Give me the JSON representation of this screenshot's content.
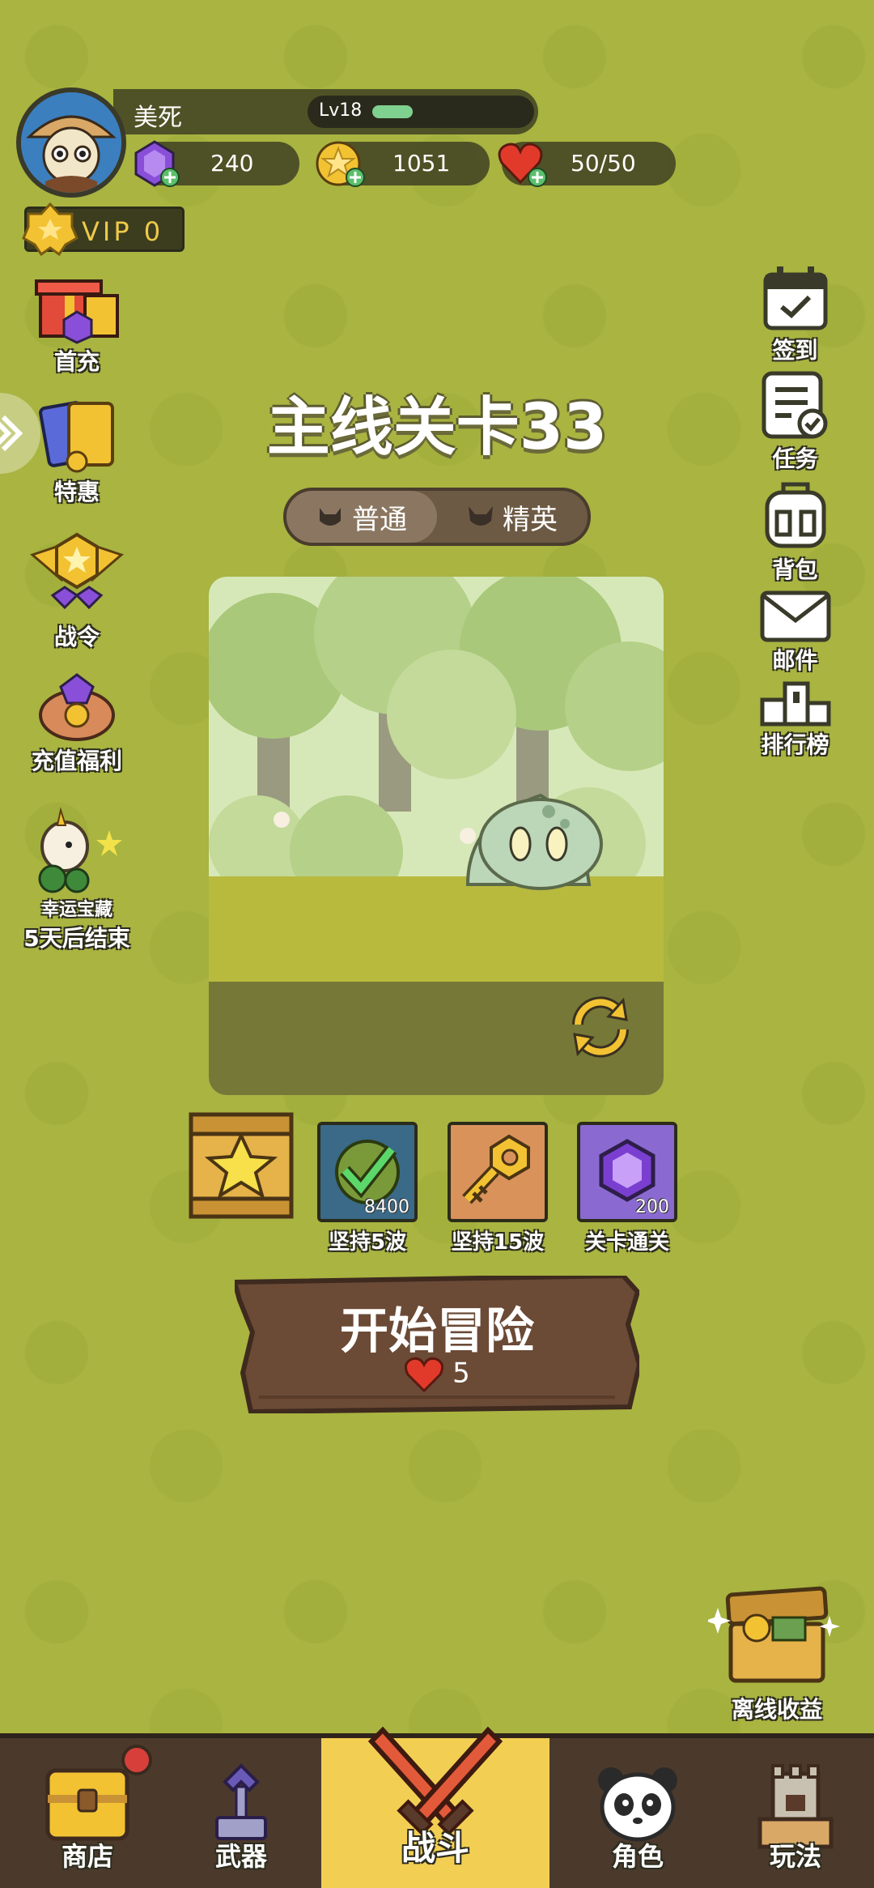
{
  "player": {
    "name": "美死",
    "level": "Lv18",
    "level_progress": 0.18,
    "vip": "VIP 0"
  },
  "resources": {
    "gems": "240",
    "coins": "1051",
    "stamina": "50/50"
  },
  "left_menu": [
    {
      "label": "首充",
      "icon": "gift-box-icon"
    },
    {
      "label": "特惠",
      "icon": "cards-icon"
    },
    {
      "label": "战令",
      "icon": "battle-pass-icon"
    },
    {
      "label": "充值福利",
      "icon": "piggy-bank-icon"
    },
    {
      "label": "幸运宝藏",
      "icon": "unicorn-treasure-icon",
      "sub": "5天后结束"
    }
  ],
  "right_menu": [
    {
      "label": "签到",
      "icon": "calendar-check-icon"
    },
    {
      "label": "任务",
      "icon": "task-list-icon"
    },
    {
      "label": "背包",
      "icon": "backpack-icon"
    },
    {
      "label": "邮件",
      "icon": "mail-icon"
    },
    {
      "label": "排行榜",
      "icon": "podium-icon"
    }
  ],
  "stage": {
    "title": "主线关卡33",
    "modes": [
      "普通",
      "精英"
    ],
    "active_mode": "普通"
  },
  "rewards": [
    {
      "label": "坚持5波",
      "count": "8400",
      "icon": "checkmark-coin-icon"
    },
    {
      "label": "坚持15波",
      "count": "",
      "icon": "golden-key-icon"
    },
    {
      "label": "关卡通关",
      "count": "200",
      "icon": "purple-gem-icon"
    }
  ],
  "start": {
    "label": "开始冒险",
    "cost": "5"
  },
  "offline": {
    "label": "离线收益"
  },
  "nav": [
    {
      "label": "商店",
      "icon": "shop-chest-icon"
    },
    {
      "label": "武器",
      "icon": "weapon-icon"
    },
    {
      "label": "战斗",
      "icon": "crossed-swords-icon"
    },
    {
      "label": "角色",
      "icon": "panda-icon"
    },
    {
      "label": "玩法",
      "icon": "castle-icon"
    }
  ],
  "colors": {
    "background": "#a9b441",
    "nav_active": "#f2cf52",
    "nav_bg": "#4b3a2c",
    "button_wood": "#6b4a36"
  }
}
